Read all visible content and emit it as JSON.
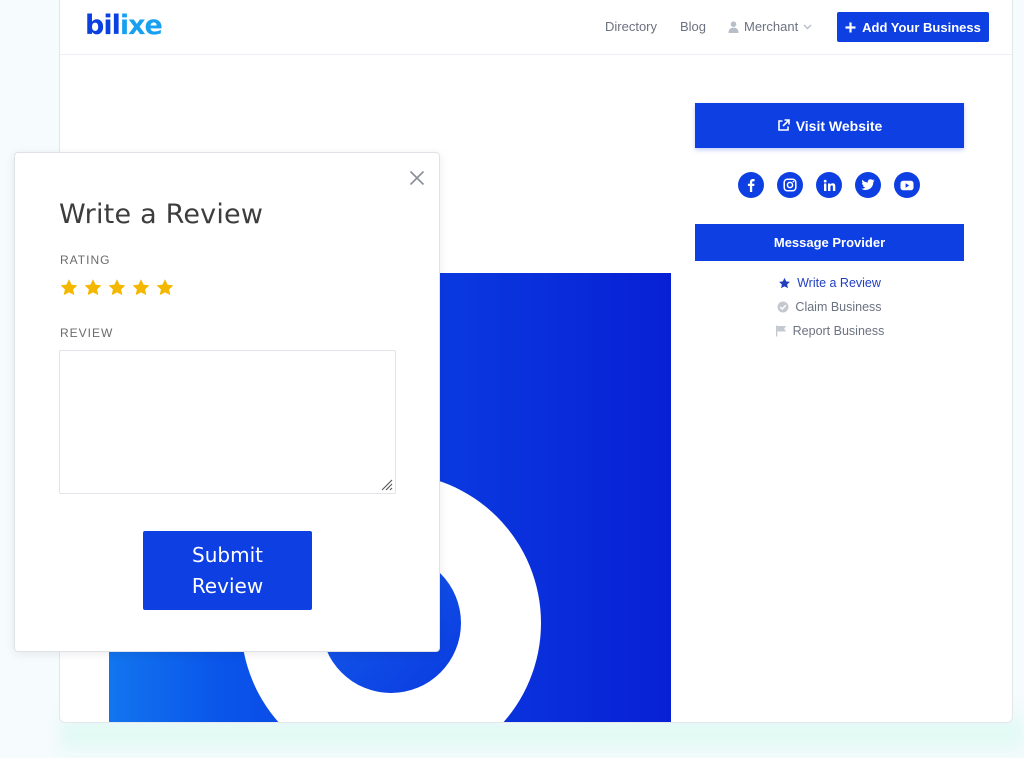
{
  "header": {
    "logo": {
      "part1": "bil",
      "part2": "ixe"
    },
    "nav": {
      "directory": "Directory",
      "blog": "Blog",
      "merchant": "Merchant"
    },
    "add_business_label": "Add Your Business"
  },
  "sidebar": {
    "visit_website_label": "Visit Website",
    "socials": [
      "facebook-icon",
      "instagram-icon",
      "linkedin-icon",
      "twitter-icon",
      "youtube-icon"
    ],
    "message_provider_label": "Message Provider",
    "links": {
      "write_review": "Write a Review",
      "claim_business": "Claim Business",
      "report_business": "Report Business"
    }
  },
  "modal": {
    "title": "Write a Review",
    "rating_label": "RATING",
    "rating_value": 5,
    "rating_max": 5,
    "review_label": "REVIEW",
    "review_value": "",
    "submit_label": "Submit Review"
  },
  "colors": {
    "brand_blue": "#0d3fe3",
    "star_gold": "#f5b800",
    "logo_light": "#18a0f0"
  }
}
